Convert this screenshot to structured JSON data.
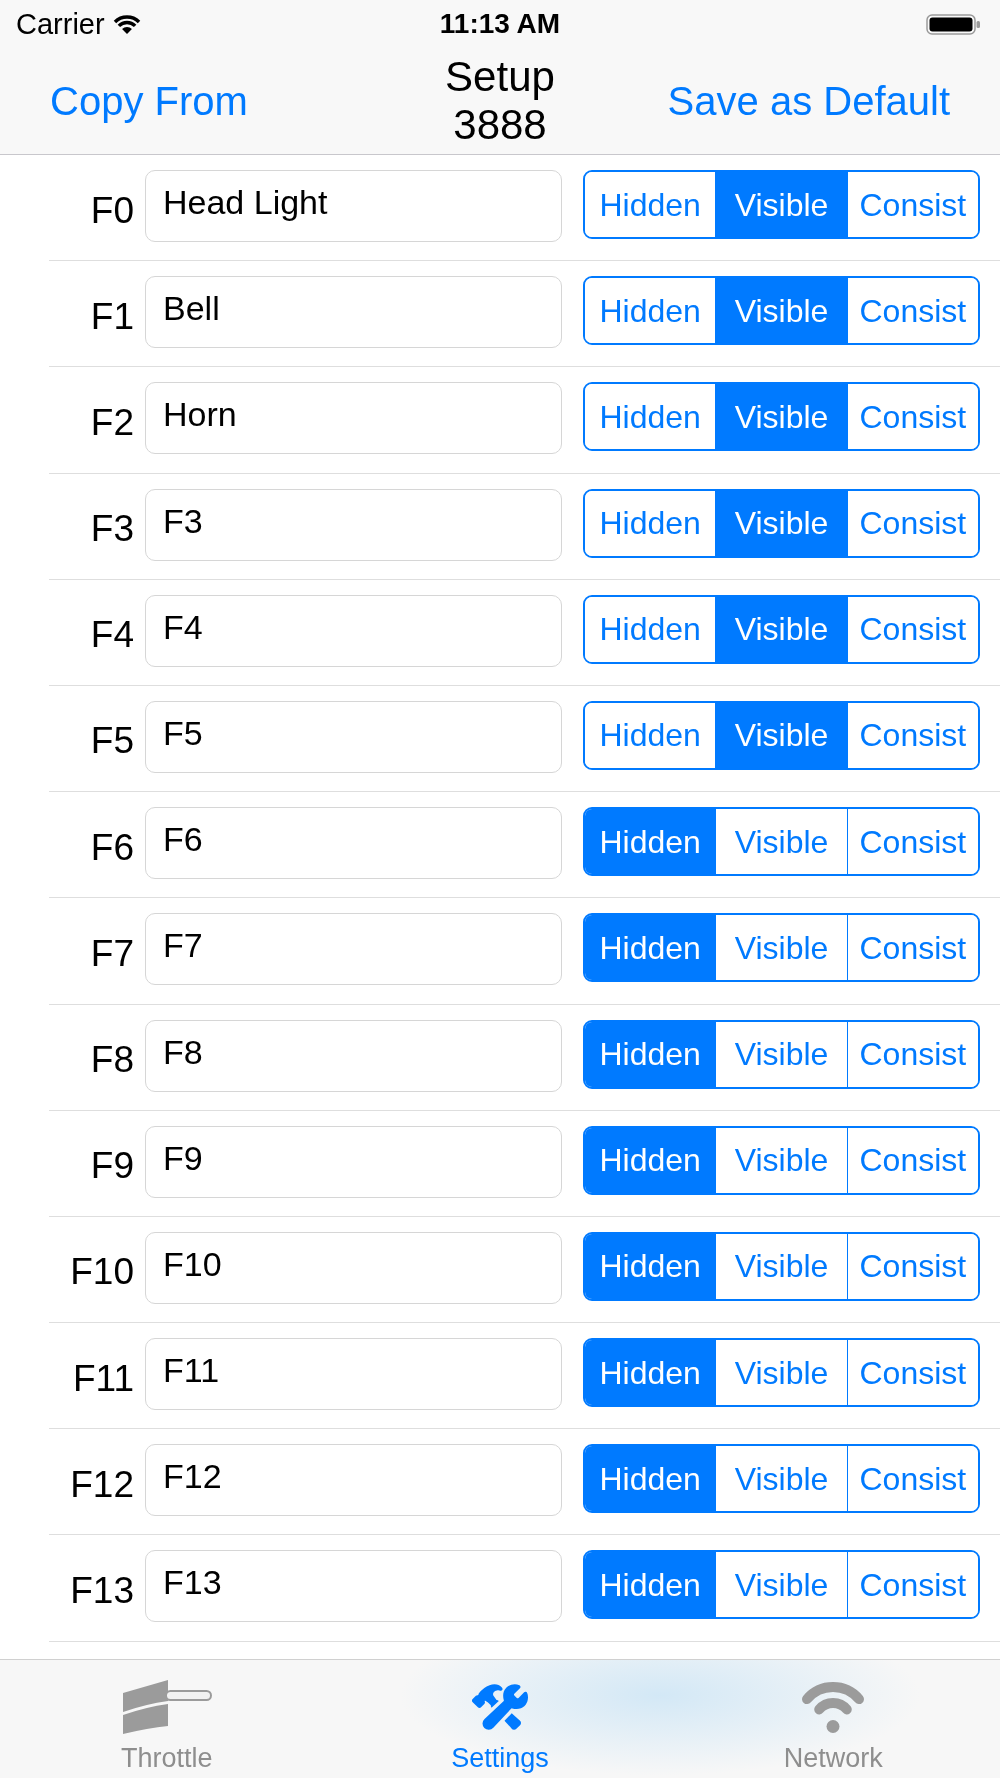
{
  "status_bar": {
    "carrier": "Carrier",
    "time": "11:13 AM"
  },
  "nav_bar": {
    "left_button": "Copy From",
    "title": "Setup 3888",
    "right_button": "Save as Default"
  },
  "functions": [
    {
      "label": "F0",
      "value": "Head Light",
      "options": [
        {
          "label": "Hidden",
          "selected": false
        },
        {
          "label": "Visible",
          "selected": true
        },
        {
          "label": "Consist",
          "selected": false
        }
      ]
    },
    {
      "label": "F1",
      "value": "Bell",
      "options": [
        {
          "label": "Hidden",
          "selected": false
        },
        {
          "label": "Visible",
          "selected": true
        },
        {
          "label": "Consist",
          "selected": false
        }
      ]
    },
    {
      "label": "F2",
      "value": "Horn",
      "options": [
        {
          "label": "Hidden",
          "selected": false
        },
        {
          "label": "Visible",
          "selected": true
        },
        {
          "label": "Consist",
          "selected": false
        }
      ]
    },
    {
      "label": "F3",
      "value": "F3",
      "options": [
        {
          "label": "Hidden",
          "selected": false
        },
        {
          "label": "Visible",
          "selected": true
        },
        {
          "label": "Consist",
          "selected": false
        }
      ]
    },
    {
      "label": "F4",
      "value": "F4",
      "options": [
        {
          "label": "Hidden",
          "selected": false
        },
        {
          "label": "Visible",
          "selected": true
        },
        {
          "label": "Consist",
          "selected": false
        }
      ]
    },
    {
      "label": "F5",
      "value": "F5",
      "options": [
        {
          "label": "Hidden",
          "selected": false
        },
        {
          "label": "Visible",
          "selected": true
        },
        {
          "label": "Consist",
          "selected": false
        }
      ]
    },
    {
      "label": "F6",
      "value": "F6",
      "options": [
        {
          "label": "Hidden",
          "selected": true
        },
        {
          "label": "Visible",
          "selected": false
        },
        {
          "label": "Consist",
          "selected": false
        }
      ]
    },
    {
      "label": "F7",
      "value": "F7",
      "options": [
        {
          "label": "Hidden",
          "selected": true
        },
        {
          "label": "Visible",
          "selected": false
        },
        {
          "label": "Consist",
          "selected": false
        }
      ]
    },
    {
      "label": "F8",
      "value": "F8",
      "options": [
        {
          "label": "Hidden",
          "selected": true
        },
        {
          "label": "Visible",
          "selected": false
        },
        {
          "label": "Consist",
          "selected": false
        }
      ]
    },
    {
      "label": "F9",
      "value": "F9",
      "options": [
        {
          "label": "Hidden",
          "selected": true
        },
        {
          "label": "Visible",
          "selected": false
        },
        {
          "label": "Consist",
          "selected": false
        }
      ]
    },
    {
      "label": "F10",
      "value": "F10",
      "options": [
        {
          "label": "Hidden",
          "selected": true
        },
        {
          "label": "Visible",
          "selected": false
        },
        {
          "label": "Consist",
          "selected": false
        }
      ]
    },
    {
      "label": "F11",
      "value": "F11",
      "options": [
        {
          "label": "Hidden",
          "selected": true
        },
        {
          "label": "Visible",
          "selected": false
        },
        {
          "label": "Consist",
          "selected": false
        }
      ]
    },
    {
      "label": "F12",
      "value": "F12",
      "options": [
        {
          "label": "Hidden",
          "selected": true
        },
        {
          "label": "Visible",
          "selected": false
        },
        {
          "label": "Consist",
          "selected": false
        }
      ]
    },
    {
      "label": "F13",
      "value": "F13",
      "options": [
        {
          "label": "Hidden",
          "selected": true
        },
        {
          "label": "Visible",
          "selected": false
        },
        {
          "label": "Consist",
          "selected": false
        }
      ]
    }
  ],
  "tab_bar": {
    "items": [
      {
        "kind": "throttle",
        "label": "Throttle",
        "selected": false
      },
      {
        "kind": "settings",
        "label": "Settings",
        "selected": true
      },
      {
        "kind": "network",
        "label": "Network",
        "selected": false
      }
    ]
  }
}
